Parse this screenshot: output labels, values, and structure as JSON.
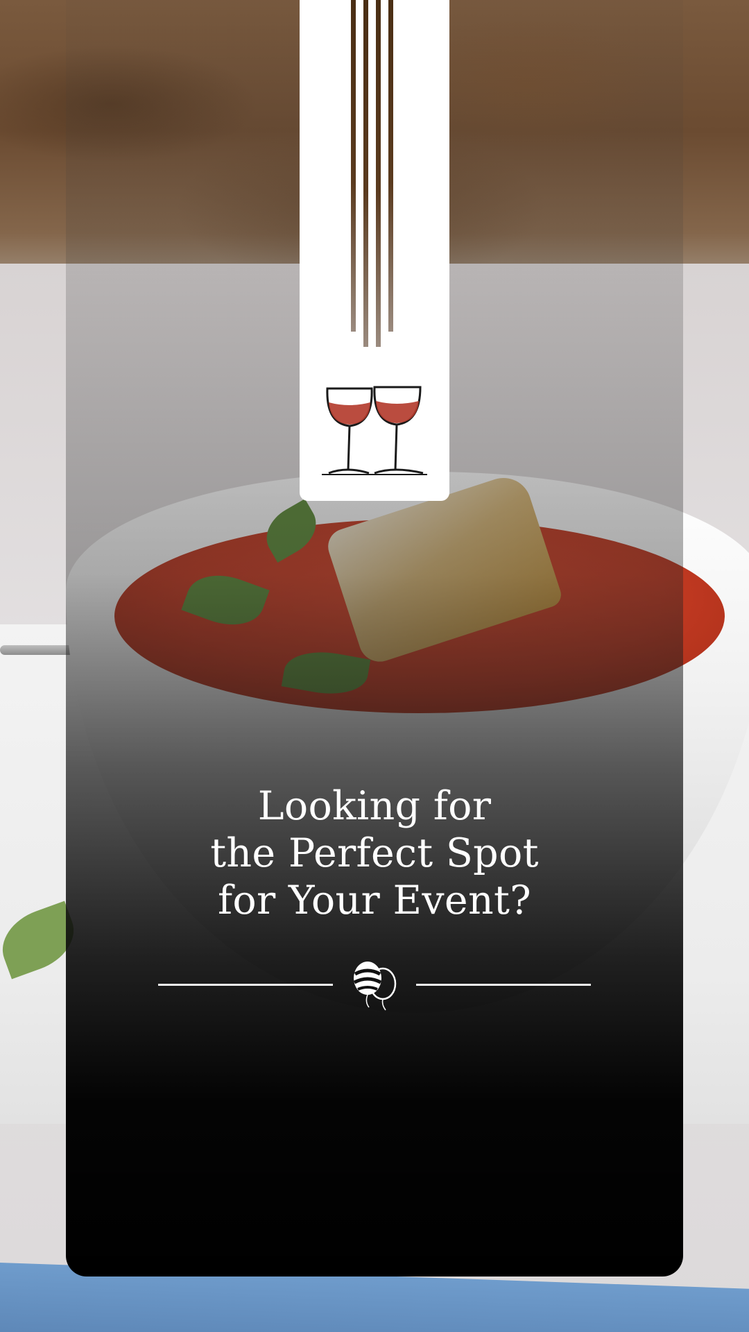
{
  "headline": {
    "line1": "Looking for",
    "line2": "the Perfect Spot",
    "line3": "for Your Event?"
  },
  "icons": {
    "banner_decoration": "vertical-stripes",
    "banner_emblem": "wine-glasses-icon",
    "divider_emblem": "balloons-icon"
  },
  "colors": {
    "text": "#ffffff",
    "banner": "#ffffff",
    "stripe": "#5a3a1e",
    "wine": "#b3392a",
    "overlay_bottom": "#000000"
  }
}
